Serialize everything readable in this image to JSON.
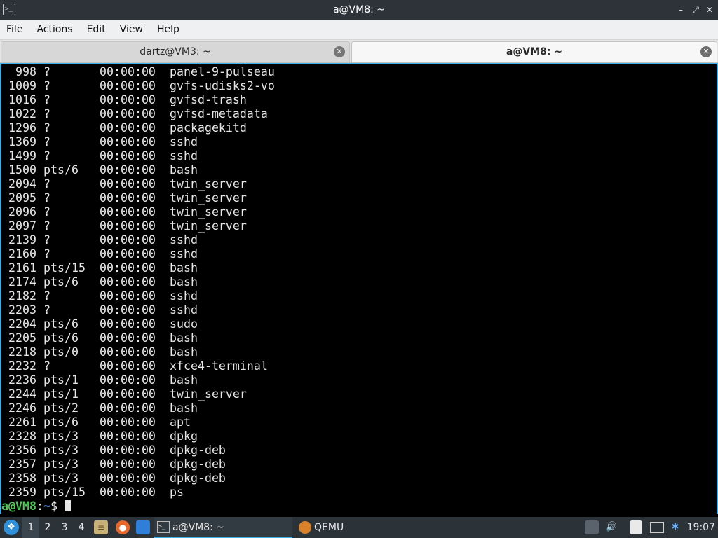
{
  "window": {
    "title": "a@VM8: ~",
    "terminal_icon_glyph": ">_"
  },
  "menubar": {
    "items": [
      "File",
      "Actions",
      "Edit",
      "View",
      "Help"
    ]
  },
  "tabs": [
    {
      "label": "dartz@VM3: ~",
      "active": false
    },
    {
      "label": "a@VM8: ~",
      "active": true
    }
  ],
  "terminal": {
    "rows": [
      {
        "pid": "998",
        "tty": "?",
        "time": "00:00:00",
        "cmd": "panel-9-pulseau"
      },
      {
        "pid": "1009",
        "tty": "?",
        "time": "00:00:00",
        "cmd": "gvfs-udisks2-vo"
      },
      {
        "pid": "1016",
        "tty": "?",
        "time": "00:00:00",
        "cmd": "gvfsd-trash"
      },
      {
        "pid": "1022",
        "tty": "?",
        "time": "00:00:00",
        "cmd": "gvfsd-metadata"
      },
      {
        "pid": "1296",
        "tty": "?",
        "time": "00:00:00",
        "cmd": "packagekitd"
      },
      {
        "pid": "1369",
        "tty": "?",
        "time": "00:00:00",
        "cmd": "sshd"
      },
      {
        "pid": "1499",
        "tty": "?",
        "time": "00:00:00",
        "cmd": "sshd"
      },
      {
        "pid": "1500",
        "tty": "pts/6",
        "time": "00:00:00",
        "cmd": "bash"
      },
      {
        "pid": "2094",
        "tty": "?",
        "time": "00:00:00",
        "cmd": "twin_server"
      },
      {
        "pid": "2095",
        "tty": "?",
        "time": "00:00:00",
        "cmd": "twin_server"
      },
      {
        "pid": "2096",
        "tty": "?",
        "time": "00:00:00",
        "cmd": "twin_server"
      },
      {
        "pid": "2097",
        "tty": "?",
        "time": "00:00:00",
        "cmd": "twin_server"
      },
      {
        "pid": "2139",
        "tty": "?",
        "time": "00:00:00",
        "cmd": "sshd"
      },
      {
        "pid": "2160",
        "tty": "?",
        "time": "00:00:00",
        "cmd": "sshd"
      },
      {
        "pid": "2161",
        "tty": "pts/15",
        "time": "00:00:00",
        "cmd": "bash"
      },
      {
        "pid": "2174",
        "tty": "pts/6",
        "time": "00:00:00",
        "cmd": "bash"
      },
      {
        "pid": "2182",
        "tty": "?",
        "time": "00:00:00",
        "cmd": "sshd"
      },
      {
        "pid": "2203",
        "tty": "?",
        "time": "00:00:00",
        "cmd": "sshd"
      },
      {
        "pid": "2204",
        "tty": "pts/6",
        "time": "00:00:00",
        "cmd": "sudo"
      },
      {
        "pid": "2205",
        "tty": "pts/6",
        "time": "00:00:00",
        "cmd": "bash"
      },
      {
        "pid": "2218",
        "tty": "pts/0",
        "time": "00:00:00",
        "cmd": "bash"
      },
      {
        "pid": "2232",
        "tty": "?",
        "time": "00:00:00",
        "cmd": "xfce4-terminal"
      },
      {
        "pid": "2236",
        "tty": "pts/1",
        "time": "00:00:00",
        "cmd": "bash"
      },
      {
        "pid": "2244",
        "tty": "pts/1",
        "time": "00:00:00",
        "cmd": "twin_server"
      },
      {
        "pid": "2246",
        "tty": "pts/2",
        "time": "00:00:00",
        "cmd": "bash"
      },
      {
        "pid": "2261",
        "tty": "pts/6",
        "time": "00:00:00",
        "cmd": "apt"
      },
      {
        "pid": "2328",
        "tty": "pts/3",
        "time": "00:00:00",
        "cmd": "dpkg"
      },
      {
        "pid": "2356",
        "tty": "pts/3",
        "time": "00:00:00",
        "cmd": "dpkg-deb"
      },
      {
        "pid": "2357",
        "tty": "pts/3",
        "time": "00:00:00",
        "cmd": "dpkg-deb"
      },
      {
        "pid": "2358",
        "tty": "pts/3",
        "time": "00:00:00",
        "cmd": "dpkg-deb"
      },
      {
        "pid": "2359",
        "tty": "pts/15",
        "time": "00:00:00",
        "cmd": "ps"
      }
    ],
    "prompt": {
      "user_host": "a@VM8",
      "separator": ":",
      "path": "~",
      "symbol": "$"
    },
    "colors": {
      "background": "#000000",
      "foreground": "#e6e6e6",
      "prompt_user": "#4ec955",
      "prompt_path": "#5c8ae6",
      "accent": "#3daee9"
    }
  },
  "taskbar": {
    "start_icon": "app-menu-icon",
    "workspaces": [
      "1",
      "2",
      "3",
      "4"
    ],
    "active_workspace": "1",
    "launchers": [
      "file-manager-icon",
      "firefox-icon",
      "desktop-icon"
    ],
    "tasks": [
      {
        "label": "a@VM8: ~",
        "icon": "terminal-icon",
        "active": true
      },
      {
        "label": "QEMU",
        "icon": "qemu-icon",
        "active": false
      }
    ],
    "tray_icons": [
      "removable-media-icon",
      "volume-icon",
      "clipboard-icon",
      "network-icon",
      "update-notifier-icon"
    ],
    "clock": "19:07"
  }
}
